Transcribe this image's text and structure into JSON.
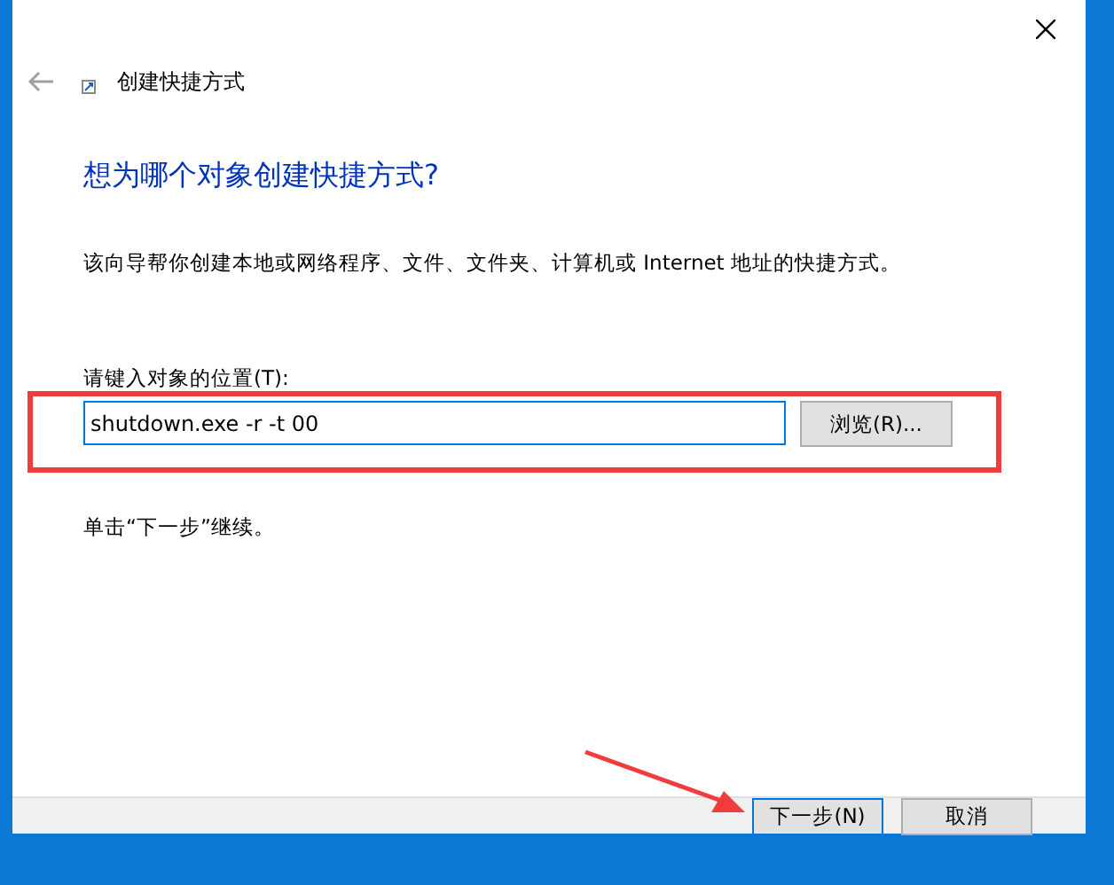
{
  "window": {
    "title": "创建快捷方式"
  },
  "heading": "想为哪个对象创建快捷方式?",
  "description": "该向导帮你创建本地或网络程序、文件、文件夹、计算机或 Internet 地址的快捷方式。",
  "location": {
    "label": "请键入对象的位置(T):",
    "value": "shutdown.exe -r -t 00",
    "browse_button": "浏览(R)..."
  },
  "hint": "单击“下一步”继续。",
  "buttons": [
    {
      "label": "下一步(N)",
      "kind": "default"
    },
    {
      "label": "取消",
      "kind": "normal"
    }
  ]
}
